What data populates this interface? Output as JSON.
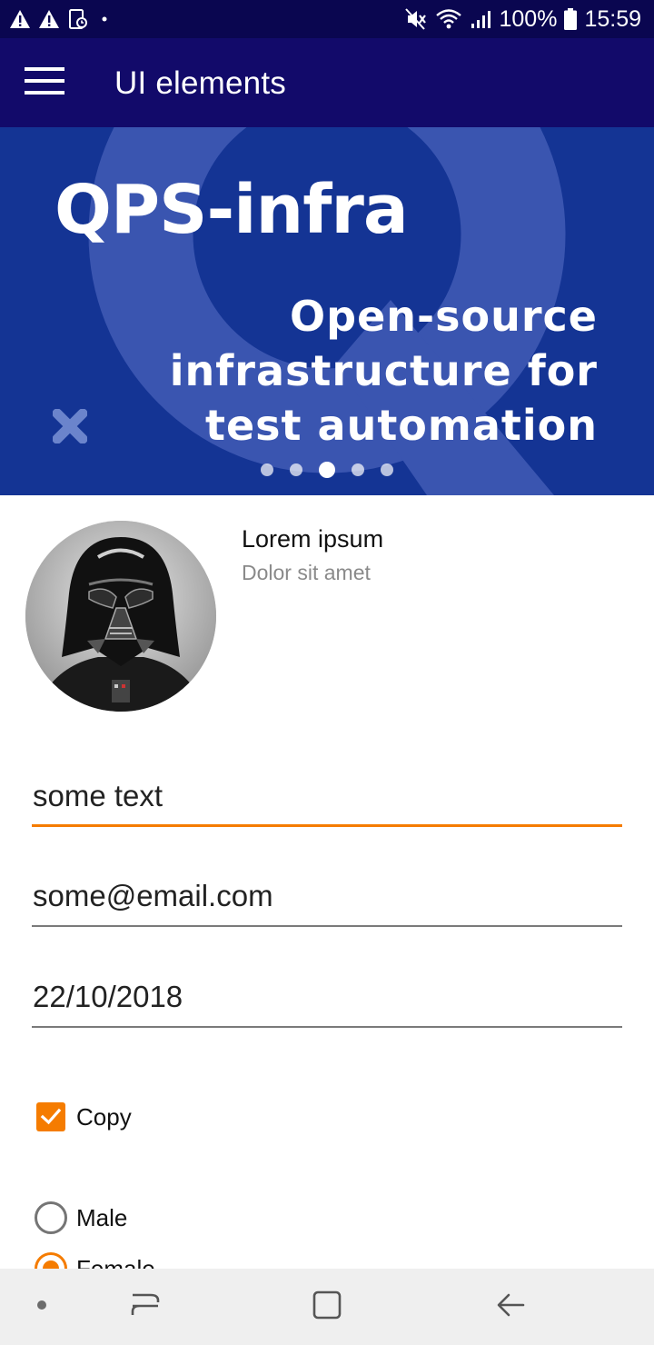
{
  "status_bar": {
    "battery": "100%",
    "time": "15:59",
    "icons_left": [
      "warning-icon",
      "warning-icon",
      "screenshot-icon",
      "dot-icon"
    ],
    "icons_right": [
      "mute-icon",
      "wifi-icon",
      "signal-icon",
      "battery-icon"
    ]
  },
  "app_bar": {
    "title": "UI elements",
    "menu_icon": "hamburger-icon",
    "background": "#120a6a"
  },
  "banner": {
    "title": "QPS-infra",
    "subtitle_lines": [
      "Open-source",
      "infrastructure for",
      "test automation"
    ],
    "background": "#143494",
    "dots_count": 5,
    "active_dot": 3
  },
  "profile": {
    "name": "Lorem ipsum",
    "subtitle": "Dolor sit amet"
  },
  "form": {
    "text_field": {
      "value": "some text"
    },
    "email_field": {
      "value": "some@email.com"
    },
    "date_field": {
      "value": "22/10/2018"
    },
    "copy_checkbox": {
      "label": "Copy",
      "checked": true
    },
    "gender": {
      "options": [
        {
          "label": "Male",
          "checked": false
        },
        {
          "label": "Female",
          "checked": true
        }
      ]
    }
  },
  "accent_color": "#f57c00",
  "nav_bar": {
    "buttons": [
      "dot-icon",
      "recents-icon",
      "home-icon",
      "back-icon"
    ]
  }
}
